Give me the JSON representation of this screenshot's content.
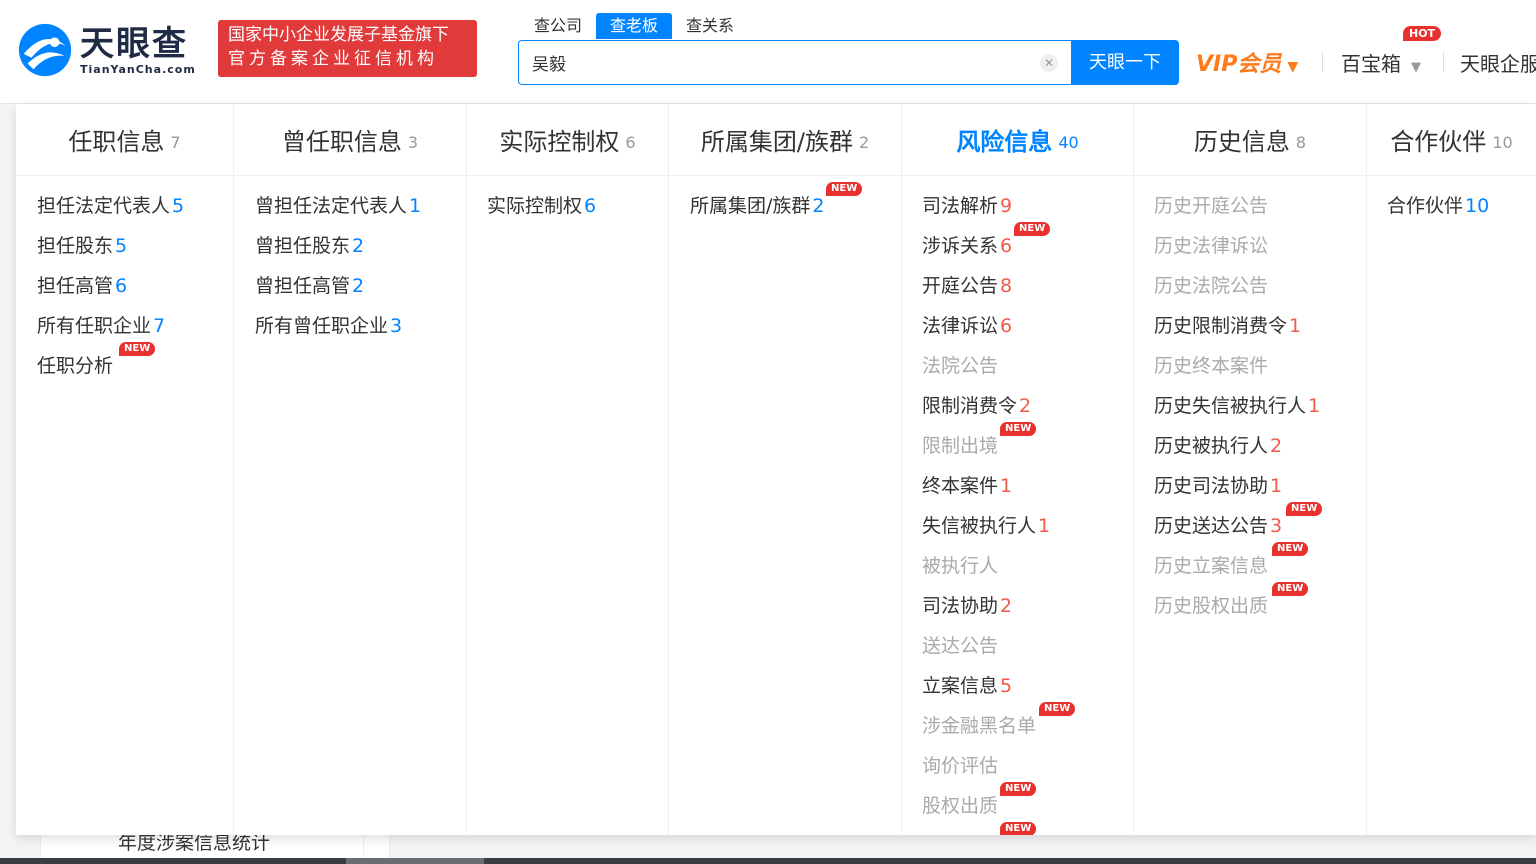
{
  "header": {
    "logo_cn": "天眼查",
    "logo_en": "TianYanCha.com",
    "slogan_line1": "国家中小企业发展子基金旗下",
    "slogan_line2": "官方备案企业征信机构",
    "search_tabs": [
      "查公司",
      "查老板",
      "查关系"
    ],
    "search_value": "吴毅",
    "search_button": "天眼一下",
    "vip_label": "VIP会员",
    "baobox_label": "百宝箱",
    "hot_badge": "HOT",
    "qiye_label": "天眼企服"
  },
  "new_badge": "NEW",
  "columns": [
    {
      "title": "任职信息",
      "count": "7",
      "items": [
        {
          "label": "担任法定代表人",
          "num": "5"
        },
        {
          "label": "担任股东",
          "num": "5"
        },
        {
          "label": "担任高管",
          "num": "6"
        },
        {
          "label": "所有任职企业",
          "num": "7"
        },
        {
          "label": "任职分析",
          "num": ""
        }
      ]
    },
    {
      "title": "曾任职信息",
      "count": "3",
      "items": [
        {
          "label": "曾担任法定代表人",
          "num": "1"
        },
        {
          "label": "曾担任股东",
          "num": "2"
        },
        {
          "label": "曾担任高管",
          "num": "2"
        },
        {
          "label": "所有曾任职企业",
          "num": "3"
        }
      ]
    },
    {
      "title": "实际控制权",
      "count": "6",
      "items": [
        {
          "label": "实际控制权",
          "num": "6"
        }
      ]
    },
    {
      "title": "所属集团/族群",
      "count": "2",
      "items": [
        {
          "label": "所属集团/族群",
          "num": "2"
        }
      ]
    },
    {
      "title": "风险信息",
      "count": "40",
      "items": [
        {
          "label": "司法解析",
          "num": "9"
        },
        {
          "label": "涉诉关系",
          "num": "6"
        },
        {
          "label": "开庭公告",
          "num": "8"
        },
        {
          "label": "法律诉讼",
          "num": "6"
        },
        {
          "label": "法院公告",
          "num": ""
        },
        {
          "label": "限制消费令",
          "num": "2"
        },
        {
          "label": "限制出境",
          "num": ""
        },
        {
          "label": "终本案件",
          "num": "1"
        },
        {
          "label": "失信被执行人",
          "num": "1"
        },
        {
          "label": "被执行人",
          "num": ""
        },
        {
          "label": "司法协助",
          "num": "2"
        },
        {
          "label": "送达公告",
          "num": ""
        },
        {
          "label": "立案信息",
          "num": "5"
        },
        {
          "label": "涉金融黑名单",
          "num": ""
        },
        {
          "label": "询价评估",
          "num": ""
        },
        {
          "label": "股权出质",
          "num": ""
        }
      ]
    },
    {
      "title": "历史信息",
      "count": "8",
      "items": [
        {
          "label": "历史开庭公告",
          "num": ""
        },
        {
          "label": "历史法律诉讼",
          "num": ""
        },
        {
          "label": "历史法院公告",
          "num": ""
        },
        {
          "label": "历史限制消费令",
          "num": "1"
        },
        {
          "label": "历史终本案件",
          "num": ""
        },
        {
          "label": "历史失信被执行人",
          "num": "1"
        },
        {
          "label": "历史被执行人",
          "num": "2"
        },
        {
          "label": "历史司法协助",
          "num": "1"
        },
        {
          "label": "历史送达公告",
          "num": "3"
        },
        {
          "label": "历史立案信息",
          "num": ""
        },
        {
          "label": "历史股权出质",
          "num": ""
        }
      ]
    },
    {
      "title": "合作伙伴",
      "count": "10",
      "items": [
        {
          "label": "合作伙伴",
          "num": "10"
        }
      ]
    }
  ],
  "background_text": "年度涉案信息统计",
  "colors": {
    "brand_blue": "#0084ff",
    "risk_red": "#f05a4a",
    "badge_red": "#e8312f",
    "vip_orange": "#ff7a1a"
  }
}
